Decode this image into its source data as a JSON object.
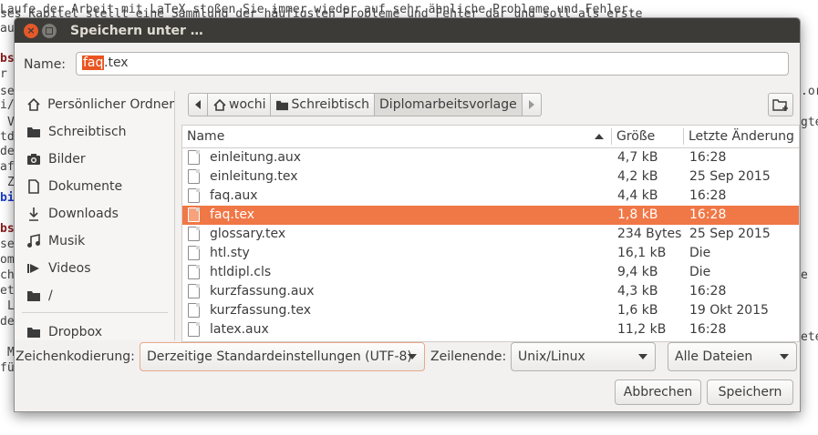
{
  "background_editor": {
    "lines": [
      "Laufe der Arbeit mit LaTeX stoßen Sie immer wieder auf sehr ähnliche Probleme und Fehler.",
      "ses Kapitel stellt eine Sammlung der häufigsten Probleme und Fehler dar und soll als erste",
      "au",
      "bs",
      "r",
      "se",
      "i/",
      "V",
      "td",
      "de",
      "af",
      "Z",
      "bi",
      "bs",
      "se",
      "om",
      "ch",
      "et",
      "L",
      "de",
      "M",
      "fü"
    ],
    "right_fragments": [
      ".or",
      "gte",
      "e",
      "ete"
    ]
  },
  "dialog": {
    "title": "Speichern unter …",
    "name_label": "Name:",
    "filename_selected": "faq",
    "filename_rest": ".tex",
    "sidebar": [
      {
        "label": "Persönlicher Ordner",
        "icon": "home-icon"
      },
      {
        "label": "Schreibtisch",
        "icon": "folder-icon"
      },
      {
        "label": "Bilder",
        "icon": "camera-icon"
      },
      {
        "label": "Dokumente",
        "icon": "document-icon"
      },
      {
        "label": "Downloads",
        "icon": "download-icon"
      },
      {
        "label": "Musik",
        "icon": "music-icon"
      },
      {
        "label": "Videos",
        "icon": "video-icon"
      },
      {
        "label": "/",
        "icon": "folder-icon"
      },
      {
        "label": "Dropbox",
        "icon": "folder-icon"
      }
    ],
    "path": [
      "wochi",
      "Schreibtisch",
      "Diplomarbeitsvorlage"
    ],
    "columns": {
      "name": "Name",
      "size": "Größe",
      "modified": "Letzte Änderung"
    },
    "files": [
      {
        "name": "einleitung.aux",
        "size": "4,7 kB",
        "modified": "16:28"
      },
      {
        "name": "einleitung.tex",
        "size": "4,2 kB",
        "modified": "25 Sep 2015"
      },
      {
        "name": "faq.aux",
        "size": "4,4 kB",
        "modified": "16:28"
      },
      {
        "name": "faq.tex",
        "size": "1,8 kB",
        "modified": "16:28",
        "selected": true
      },
      {
        "name": "glossary.tex",
        "size": "234 Bytes",
        "modified": "25 Sep 2015"
      },
      {
        "name": "htl.sty",
        "size": "16,1 kB",
        "modified": "Die"
      },
      {
        "name": "htldipl.cls",
        "size": "9,4 kB",
        "modified": "Die"
      },
      {
        "name": "kurzfassung.aux",
        "size": "4,3 kB",
        "modified": "16:28"
      },
      {
        "name": "kurzfassung.tex",
        "size": "1,6 kB",
        "modified": "19 Okt 2015"
      },
      {
        "name": "latex.aux",
        "size": "11,2 kB",
        "modified": "16:28"
      }
    ],
    "encoding_label": "Zeichenkodierung:",
    "encoding_value": "Derzeitige Standardeinstellungen (UTF-8)",
    "lineend_label": "Zeilenende:",
    "lineend_value": "Unix/Linux",
    "filter_value": "Alle Dateien",
    "cancel_label": "Abbrechen",
    "save_label": "Speichern",
    "colors": {
      "accent": "#e95420",
      "selection": "#f07746",
      "titlebar": "#3c3b37"
    }
  }
}
